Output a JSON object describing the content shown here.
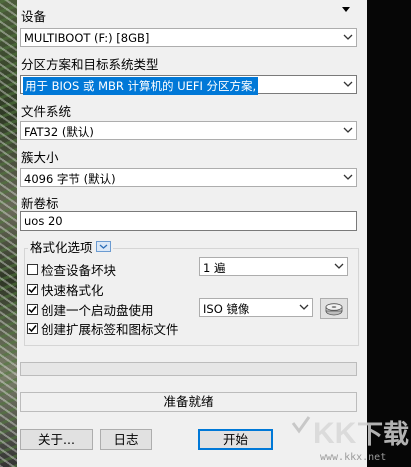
{
  "device": {
    "label": "设备",
    "value": "MULTIBOOT (F:) [8GB]"
  },
  "partition_scheme": {
    "label": "分区方案和目标系统类型",
    "value": "用于 BIOS 或 MBR 计算机的 UEFI 分区方案,"
  },
  "file_system": {
    "label": "文件系统",
    "value": "FAT32 (默认)"
  },
  "cluster_size": {
    "label": "簇大小",
    "value": "4096 字节 (默认)"
  },
  "volume_label": {
    "label": "新卷标",
    "value": "uos 20"
  },
  "format_options": {
    "title": "格式化选项",
    "check_bad_blocks": {
      "label": "检查设备坏块",
      "checked": false,
      "passes": "1 遍"
    },
    "quick_format": {
      "label": "快速格式化",
      "checked": true
    },
    "bootable": {
      "label": "创建一个启动盘使用",
      "checked": true,
      "image_type": "ISO 镜像"
    },
    "extended_label": {
      "label": "创建扩展标签和图标文件",
      "checked": true
    }
  },
  "progress": 0,
  "status": "准备就绪",
  "buttons": {
    "about": "关于...",
    "log": "日志",
    "start": "开始"
  },
  "watermark_text": "www.kkx.net",
  "icons": {
    "dropdown": "chevron-down-icon",
    "disk": "disk-drive-icon",
    "checkmark": "checkmark-icon",
    "collapse": "collapse-icon"
  },
  "colors": {
    "selection": "#0078d7",
    "panel": "#f0f0f0"
  }
}
